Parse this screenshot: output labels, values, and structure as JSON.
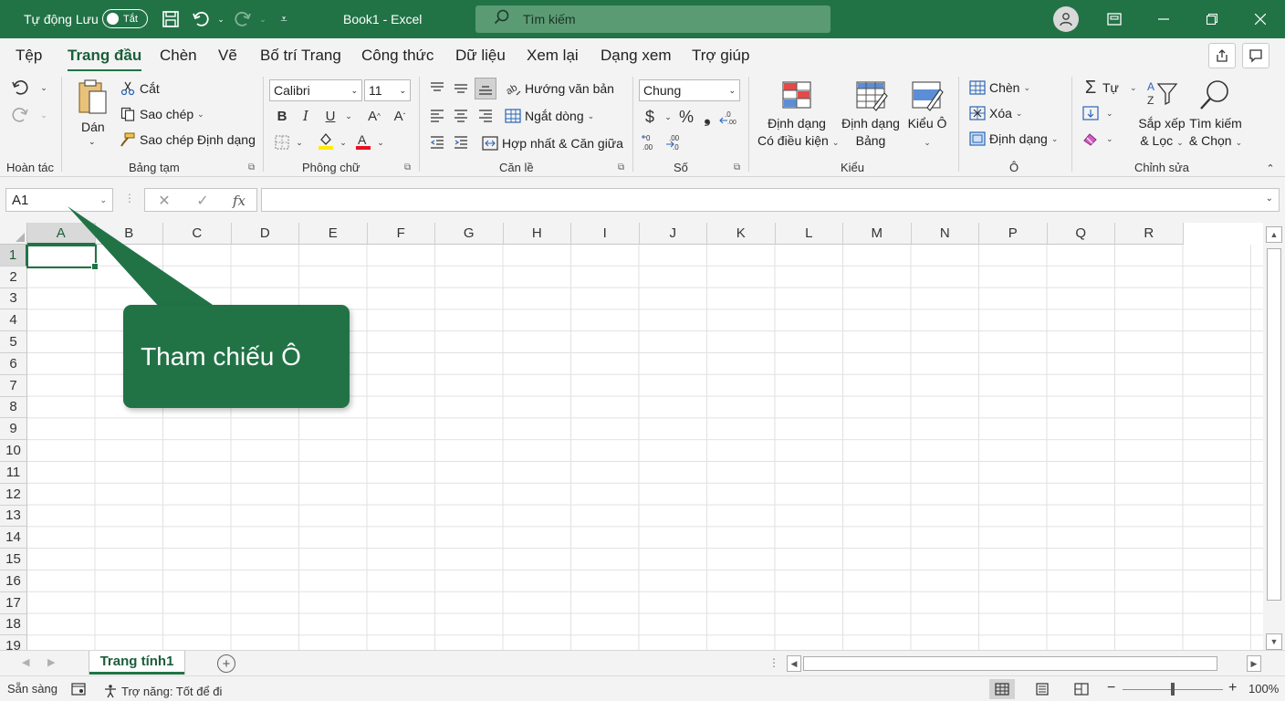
{
  "titlebar": {
    "autosave_label": "Tự động Lưu",
    "autosave_state": "Tắt",
    "doc_title": "Book1  -  Excel",
    "search_placeholder": "Tìm kiếm"
  },
  "tabs": [
    "Tệp",
    "Trang đầu",
    "Chèn",
    "Vẽ",
    "Bố trí Trang",
    "Công thức",
    "Dữ liệu",
    "Xem lại",
    "Dạng xem",
    "Trợ giúp"
  ],
  "ribbon": {
    "undo_group": "Hoàn tác",
    "clipboard": {
      "label": "Bảng tạm",
      "paste": "Dán",
      "cut": "Cắt",
      "copy": "Sao chép",
      "format_painter": "Sao chép Định dạng"
    },
    "font": {
      "label": "Phông chữ",
      "name": "Calibri",
      "size": "11"
    },
    "alignment": {
      "label": "Căn lề",
      "orientation": "Hướng văn bản",
      "wrap": "Ngắt dòng",
      "merge": "Hợp nhất & Căn giữa"
    },
    "number": {
      "label": "Số",
      "format": "Chung"
    },
    "styles": {
      "label": "Kiểu",
      "conditional_1": "Định dạng",
      "conditional_2": "Có điều kiện",
      "table_1": "Định dạng",
      "table_2": "Bảng",
      "cell_styles": "Kiểu Ô"
    },
    "cells": {
      "label": "Ô",
      "insert": "Chèn",
      "delete": "Xóa",
      "format": "Định dạng"
    },
    "editing": {
      "label": "Chỉnh sửa",
      "autosum": "Tự",
      "sort_1": "Sắp xếp",
      "sort_2": "& Lọc",
      "find_1": "Tìm kiếm",
      "find_2": "& Chọn"
    }
  },
  "formula_bar": {
    "name_box": "A1",
    "fx": "fx"
  },
  "grid": {
    "columns": [
      "A",
      "B",
      "C",
      "D",
      "E",
      "F",
      "G",
      "H",
      "I",
      "J",
      "K",
      "L",
      "M",
      "N",
      "P",
      "Q",
      "R"
    ],
    "rows": [
      "1",
      "2",
      "3",
      "4",
      "5",
      "6",
      "7",
      "8",
      "9",
      "10",
      "11",
      "12",
      "13",
      "14",
      "15",
      "16",
      "17",
      "18",
      "19"
    ]
  },
  "sheet_tabs": [
    "Trang tính1"
  ],
  "statusbar": {
    "ready": "Sẵn sàng",
    "accessibility": "Trợ năng: Tốt để đi",
    "zoom": "100%"
  },
  "callout": {
    "text": "Tham chiếu Ô"
  },
  "colors": {
    "excel_green": "#217346",
    "ribbon_bg": "#f3f3f3"
  }
}
